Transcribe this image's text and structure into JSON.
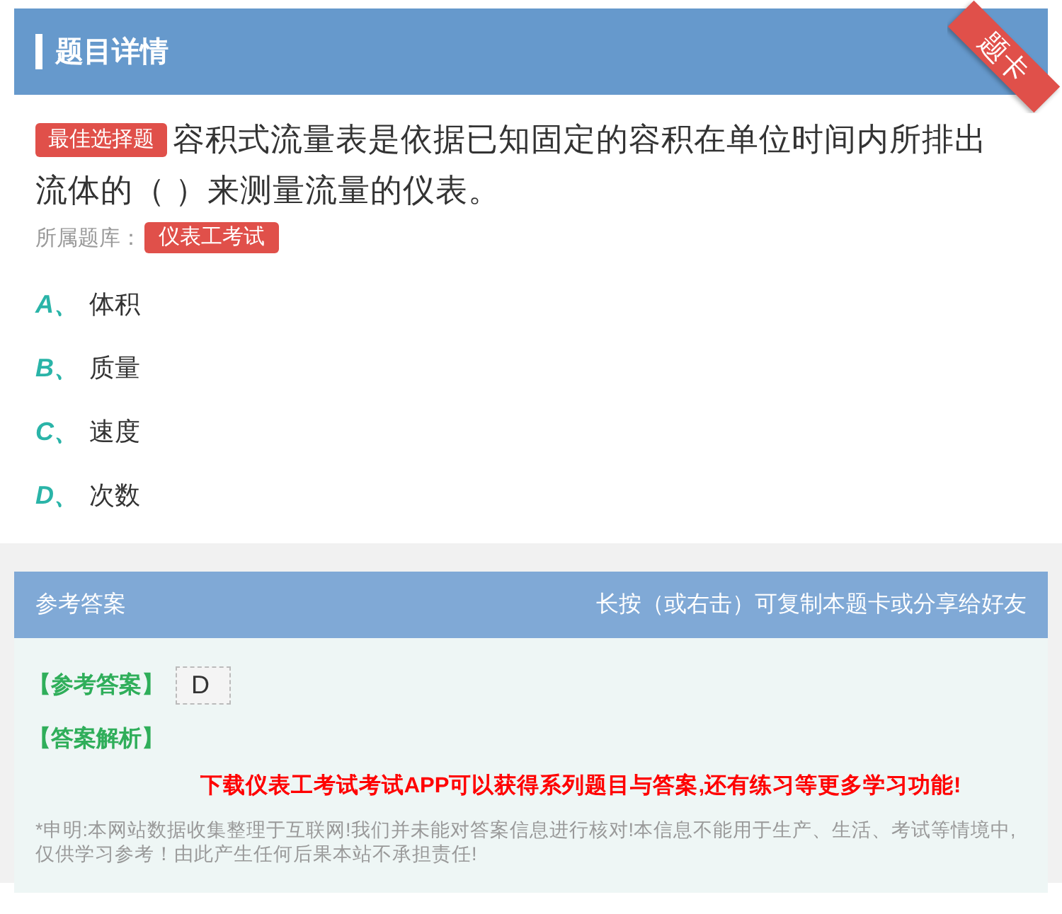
{
  "header": {
    "title": "题目详情",
    "ribbon": "题卡"
  },
  "question": {
    "type_tag": "最佳选择题",
    "text": "容积式流量表是依据已知固定的容积在单位时间内所排出流体的（ ）来测量流量的仪表。",
    "bank_label": "所属题库：",
    "bank_tag": "仪表工考试"
  },
  "options": [
    {
      "letter": "A、",
      "text": "体积"
    },
    {
      "letter": "B、",
      "text": "质量"
    },
    {
      "letter": "C、",
      "text": "速度"
    },
    {
      "letter": "D、",
      "text": "次数"
    }
  ],
  "answer_bar": {
    "title": "参考答案",
    "hint": "长按（或右击）可复制本题卡或分享给好友"
  },
  "answer": {
    "label": "【参考答案】",
    "value": "D",
    "analysis_label": "【答案解析】",
    "promo": "下载仪表工考试考试APP可以获得系列题目与答案,还有练习等更多学习功能!",
    "disclaimer": "*申明:本网站数据收集整理于互联网!我们并未能对答案信息进行核对!本信息不能用于生产、生活、考试等情境中,仅供学习参考！由此产生任何后果本站不承担责任!"
  }
}
